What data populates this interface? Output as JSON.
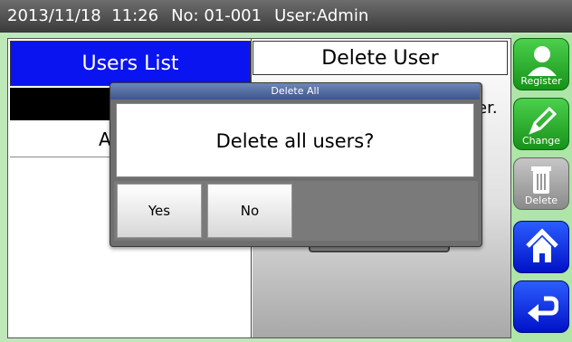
{
  "statusbar": {
    "datetime": "2013/11/18  11:26",
    "number": "No: 01-001",
    "user": "User:Admin"
  },
  "tabs": {
    "users_list": "Users List",
    "delete_user": "Delete User"
  },
  "list": {
    "row2_partial": "A"
  },
  "right_panel": {
    "text_partial": "er."
  },
  "sidebar": {
    "items": [
      {
        "label": "Register",
        "icon": "user-add-icon"
      },
      {
        "label": "Change",
        "icon": "pencil-icon"
      },
      {
        "label": "Delete",
        "icon": "trash-icon"
      },
      {
        "label": "",
        "icon": "home-icon"
      },
      {
        "label": "",
        "icon": "back-icon"
      }
    ]
  },
  "dialog": {
    "title": "Delete All",
    "message": "Delete all users?",
    "yes_label": "Yes",
    "no_label": "No"
  },
  "colors": {
    "tab_active": "#0a14f0",
    "side_green": "#17921a",
    "side_blue": "#0012c8",
    "side_gray": "#8a8a8a"
  }
}
